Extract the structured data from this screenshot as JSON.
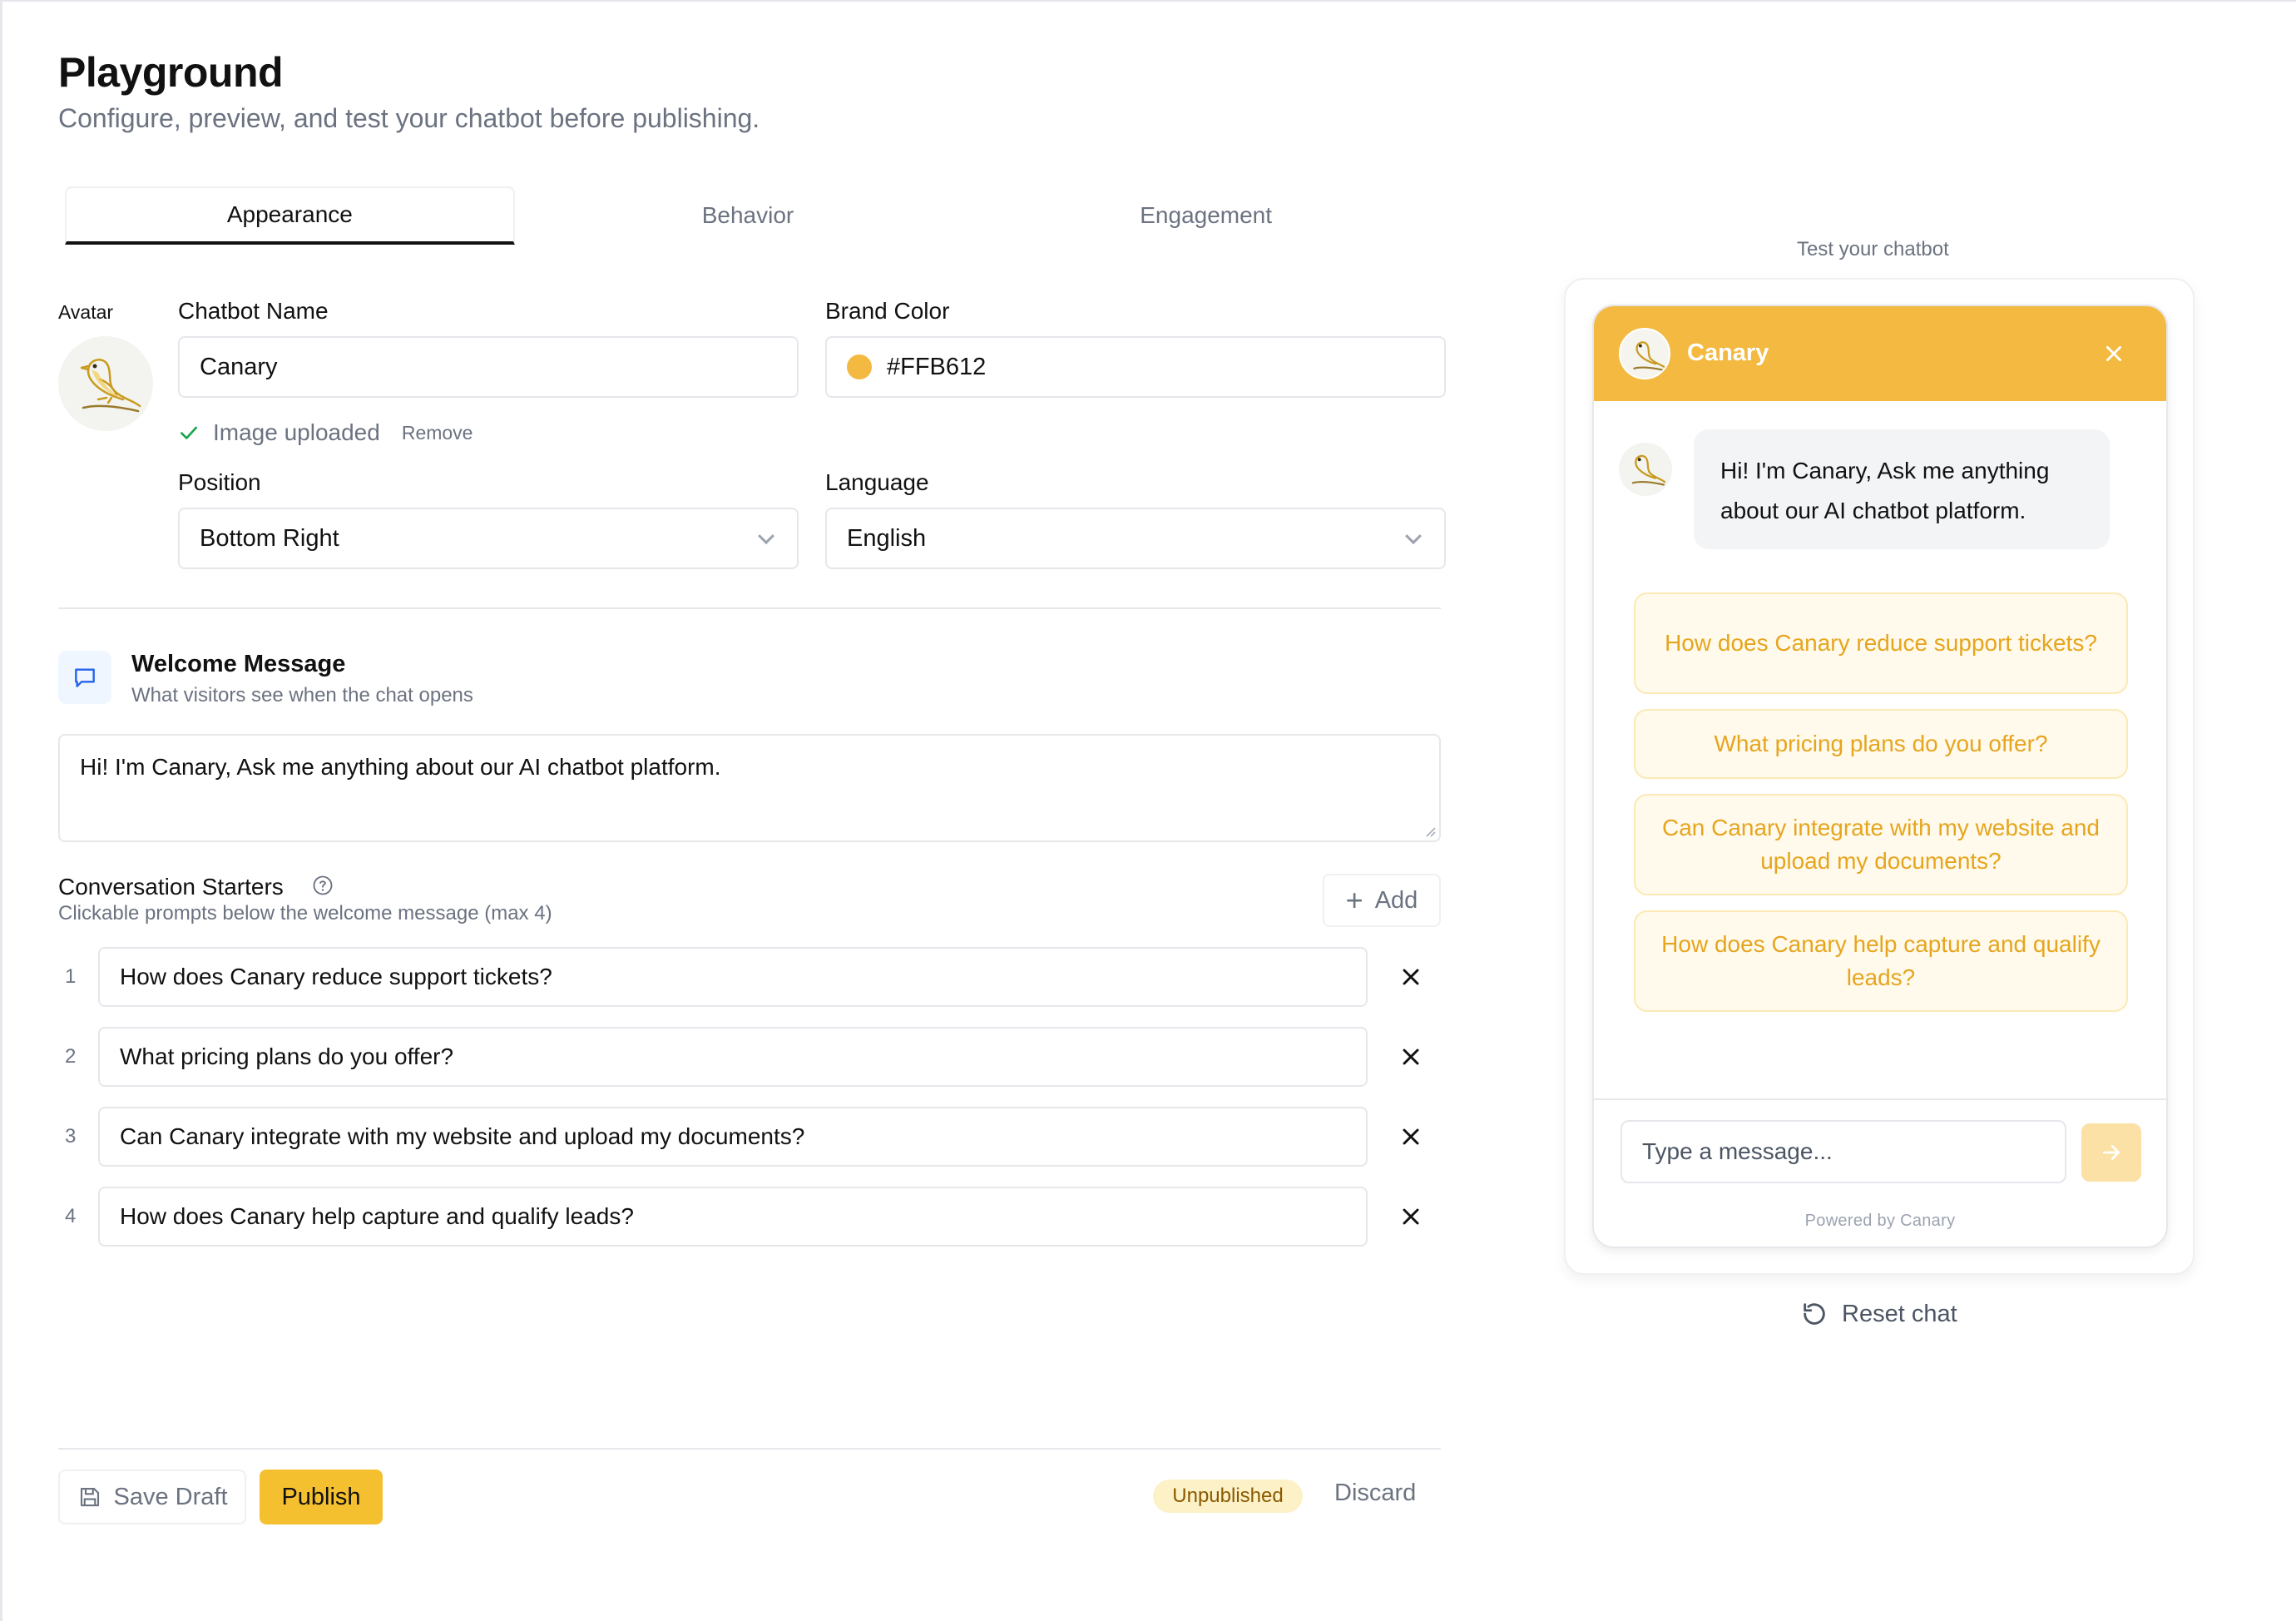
{
  "header": {
    "title": "Playground",
    "subtitle": "Configure, preview, and test your chatbot before publishing."
  },
  "tabs": [
    {
      "label": "Appearance",
      "active": true
    },
    {
      "label": "Behavior",
      "active": false
    },
    {
      "label": "Engagement",
      "active": false
    }
  ],
  "appearance": {
    "avatar_label": "Avatar",
    "name_label": "Chatbot Name",
    "name_value": "Canary",
    "brand_color_label": "Brand Color",
    "brand_color_value": "#FFB612",
    "upload_status": "Image uploaded",
    "remove_label": "Remove",
    "position_label": "Position",
    "position_value": "Bottom Right",
    "language_label": "Language",
    "language_value": "English"
  },
  "welcome": {
    "title": "Welcome Message",
    "subtitle": "What visitors see when the chat opens",
    "message": "Hi! I'm Canary, Ask me anything about our AI chatbot platform."
  },
  "starters": {
    "title": "Conversation Starters",
    "subtitle": "Clickable prompts below the welcome message (max 4)",
    "add_label": "Add",
    "items": [
      {
        "num": "1",
        "text": "How does Canary reduce support tickets?"
      },
      {
        "num": "2",
        "text": "What pricing plans do you offer?"
      },
      {
        "num": "3",
        "text": "Can Canary integrate with my website and upload my documents?"
      },
      {
        "num": "4",
        "text": "How does Canary help capture and qualify leads?"
      }
    ]
  },
  "actions": {
    "save_draft": "Save Draft",
    "publish": "Publish",
    "status_badge": "Unpublished",
    "discard": "Discard"
  },
  "preview": {
    "label": "Test your chatbot",
    "bot_name": "Canary",
    "bot_message": "Hi! I'm Canary, Ask me anything about our AI chatbot platform.",
    "chips": [
      "How does Canary reduce support tickets?",
      "What pricing plans do you offer?",
      "Can Canary integrate with my website and upload my documents?",
      "How does Canary help capture and qualify leads?"
    ],
    "input_placeholder": "Type a message...",
    "powered_by": "Powered by Canary",
    "reset_label": "Reset chat"
  },
  "colors": {
    "brand": "#F4B940",
    "publish": "#F5C02F",
    "chip_text": "#E6A51F",
    "chip_bg": "#FFFAEB"
  },
  "icons": {
    "avatar": "canary-bird-icon",
    "upload_status": "check-icon",
    "welcome": "message-square-icon",
    "help": "question-circle-icon",
    "add": "plus-icon",
    "starter_remove": "close-icon",
    "save": "save-icon",
    "send": "arrow-right-icon",
    "reset": "rotate-ccw-icon"
  }
}
